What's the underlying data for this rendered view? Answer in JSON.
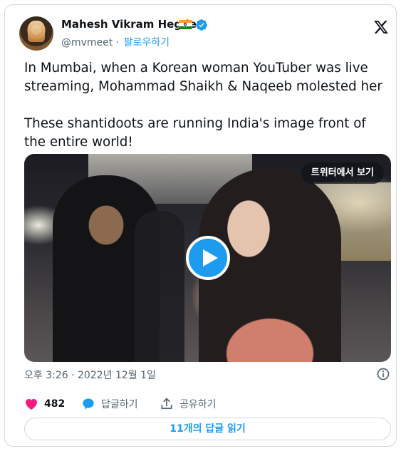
{
  "author": {
    "name": "Mahesh Vikram Hegde",
    "handle": "@mvmeet",
    "follow_label": "팔로우하기",
    "badges": [
      "flag-india-icon",
      "verified-badge-icon"
    ]
  },
  "tweet": {
    "paragraphs": [
      "In Mumbai, when a Korean woman YouTuber was live streaming, Mohammad Shaikh & Naqeeb molested her",
      "These shantidoots are running India's image front of the entire world!"
    ]
  },
  "media": {
    "type": "video",
    "view_on_twitter_label": "트위터에서 보기",
    "play_icon": "play-icon"
  },
  "timestamp": "오후 3:26 · 2022년 12월 1일",
  "actions": {
    "likes_count": "482",
    "reply_label": "답글하기",
    "share_label": "공유하기"
  },
  "read_replies_label": "11개의 답글 읽기",
  "colors": {
    "accent": "#1d9bf0",
    "like": "#f91880",
    "text": "#0f1419",
    "secondary": "#536471",
    "border": "#cfd9de"
  }
}
